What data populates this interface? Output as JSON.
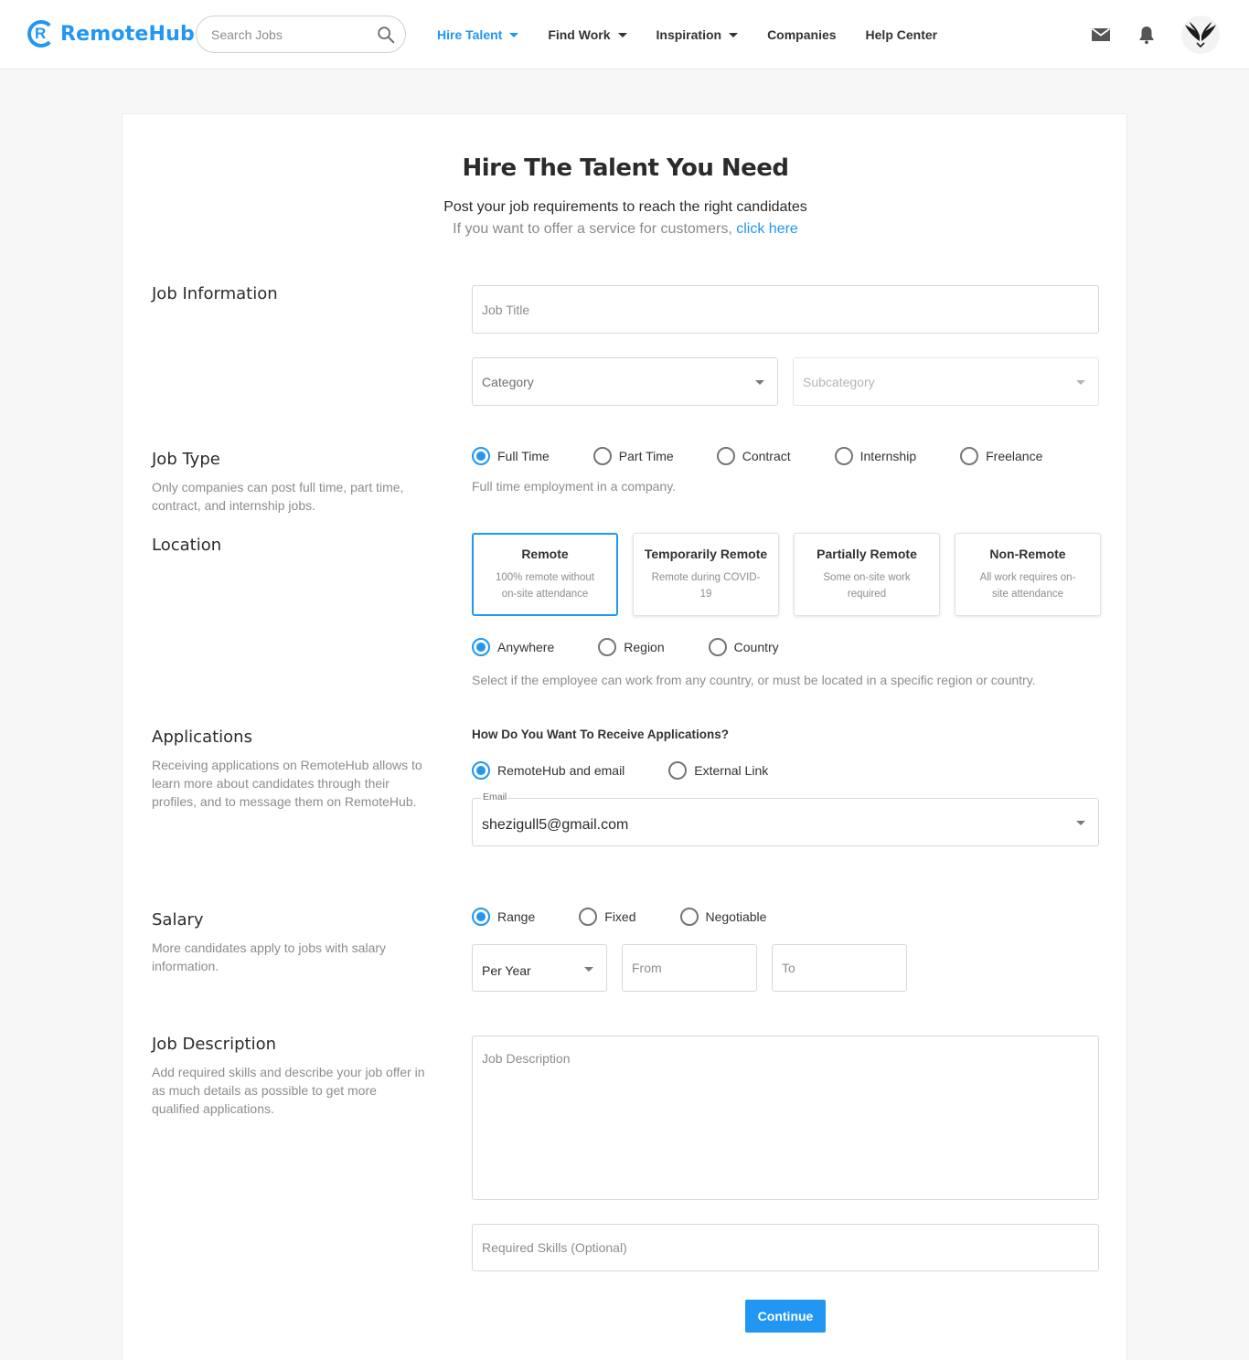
{
  "brand": {
    "name": "RemoteHub",
    "accent": "#2196f3"
  },
  "header": {
    "search_placeholder": "Search Jobs",
    "nav": [
      {
        "label": "Hire Talent",
        "dropdown": true,
        "active": true
      },
      {
        "label": "Find Work",
        "dropdown": true,
        "active": false
      },
      {
        "label": "Inspiration",
        "dropdown": true,
        "active": false
      },
      {
        "label": "Companies",
        "dropdown": false,
        "active": false
      },
      {
        "label": "Help Center",
        "dropdown": false,
        "active": false
      }
    ],
    "icons": [
      "mail-icon",
      "bell-icon",
      "avatar"
    ]
  },
  "intro": {
    "title": "Hire The Talent You Need",
    "subtitle": "Post your job requirements to reach the right candidates",
    "service_prefix": "If you want to offer a service for customers, ",
    "service_link": "click here"
  },
  "job_information": {
    "title": "Job Information",
    "job_title_placeholder": "Job Title",
    "category_placeholder": "Category",
    "subcategory_placeholder": "Subcategory"
  },
  "job_type": {
    "title": "Job Type",
    "description": "Only companies can post full time, part time, contract, and internship jobs.",
    "options": [
      "Full Time",
      "Part Time",
      "Contract",
      "Internship",
      "Freelance"
    ],
    "selected": "Full Time",
    "helper": "Full time employment in a company."
  },
  "location": {
    "title": "Location",
    "cards": [
      {
        "title": "Remote",
        "desc": "100% remote without on-site attendance",
        "selected": true
      },
      {
        "title": "Temporarily Remote",
        "desc": "Remote during COVID-19",
        "selected": false
      },
      {
        "title": "Partially Remote",
        "desc": "Some on-site work required",
        "selected": false
      },
      {
        "title": "Non-Remote",
        "desc": "All work requires on-site attendance",
        "selected": false
      }
    ],
    "scope_options": [
      "Anywhere",
      "Region",
      "Country"
    ],
    "scope_selected": "Anywhere",
    "helper": "Select if the employee can work from any country, or must be located in a specific region or country."
  },
  "applications": {
    "title": "Applications",
    "description": "Receiving applications on RemoteHub allows to learn more about candidates through their profiles, and to message them on RemoteHub.",
    "question": "How Do You Want To Receive Applications?",
    "options": [
      "RemoteHub and email",
      "External Link"
    ],
    "selected": "RemoteHub and email",
    "email_label": "Email",
    "email_value": "shezigull5@gmail.com"
  },
  "salary": {
    "title": "Salary",
    "description": "More candidates apply to jobs with salary information.",
    "options": [
      "Range",
      "Fixed",
      "Negotiable"
    ],
    "selected": "Range",
    "period_value": "Per Year",
    "from_placeholder": "From",
    "to_placeholder": "To"
  },
  "job_description": {
    "title": "Job Description",
    "description": "Add required skills and describe your job offer in as much details as possible to get more qualified applications.",
    "description_placeholder": "Job Description",
    "skills_placeholder": "Required Skills (Optional)"
  },
  "actions": {
    "continue_label": "Continue"
  }
}
